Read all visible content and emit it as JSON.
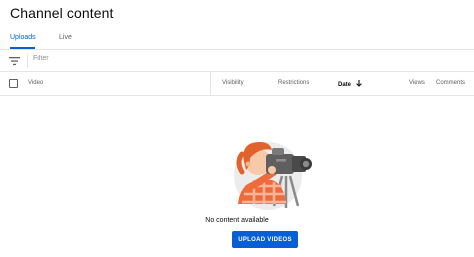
{
  "page": {
    "title": "Channel content"
  },
  "tabs": [
    {
      "label": "Uploads",
      "active": true
    },
    {
      "label": "Live",
      "active": false
    }
  ],
  "filter": {
    "placeholder": "Filter",
    "icon": "filter-icon"
  },
  "table": {
    "columns": {
      "video": "Video",
      "visibility": "Visibility",
      "restrictions": "Restrictions",
      "date": "Date",
      "views": "Views",
      "comments": "Comments"
    },
    "sort": {
      "column": "Date",
      "direction": "descending",
      "icon": "arrow-down-icon"
    }
  },
  "empty_state": {
    "message": "No content available",
    "button_label": "UPLOAD VIDEOS",
    "illustration": "camera-operator-illustration"
  },
  "colors": {
    "accent": "#065fd4",
    "text_secondary": "#606060",
    "divider": "#e5e5e5"
  }
}
